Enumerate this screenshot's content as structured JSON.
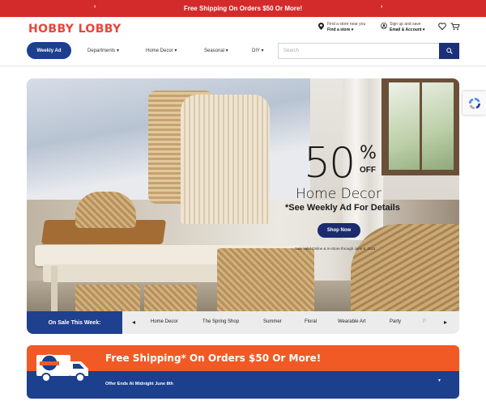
{
  "promo_bar": {
    "text": "Free Shipping On Orders $50 Or More!",
    "prev": "‹",
    "next": "›",
    "color": "#d32b2b"
  },
  "header": {
    "logo": "HOBBY LOBBY",
    "store": {
      "top": "Find a store near you",
      "bottom": "Find a store ▾"
    },
    "account": {
      "top": "Sign up and save",
      "bottom": "Email & Account ▾"
    }
  },
  "nav": {
    "weekly_ad": "Weekly Ad",
    "menus": [
      "Departments ▾",
      "Home Decor ▾",
      "Seasonal ▾",
      "DIY ▾"
    ],
    "search_placeholder": "Search"
  },
  "hero": {
    "percent": "50",
    "percent_sign": "%",
    "off": "OFF",
    "headline": "Home Decor",
    "subline": "*See Weekly Ad For Details",
    "cta": "Shop Now",
    "fine_print": "Sale Valid Online & In-Store through June 8, 2024"
  },
  "on_sale": {
    "label": "On Sale This Week:",
    "prev": "◂",
    "next": "▸",
    "items": [
      "Home Decor",
      "The Spring Shop",
      "Summer",
      "Floral",
      "Wearable Art",
      "Party",
      "P"
    ]
  },
  "free_shipping": {
    "title": "Free Shipping* On Orders $50 Or More!",
    "sub": "Offer Ends At Midnight June 8th",
    "chevron": "▾",
    "truck_badge": "FREE SHIPPING"
  },
  "colors": {
    "brand_red": "#e8453a",
    "navy": "#1c3f8e",
    "orange": "#f15a24"
  }
}
